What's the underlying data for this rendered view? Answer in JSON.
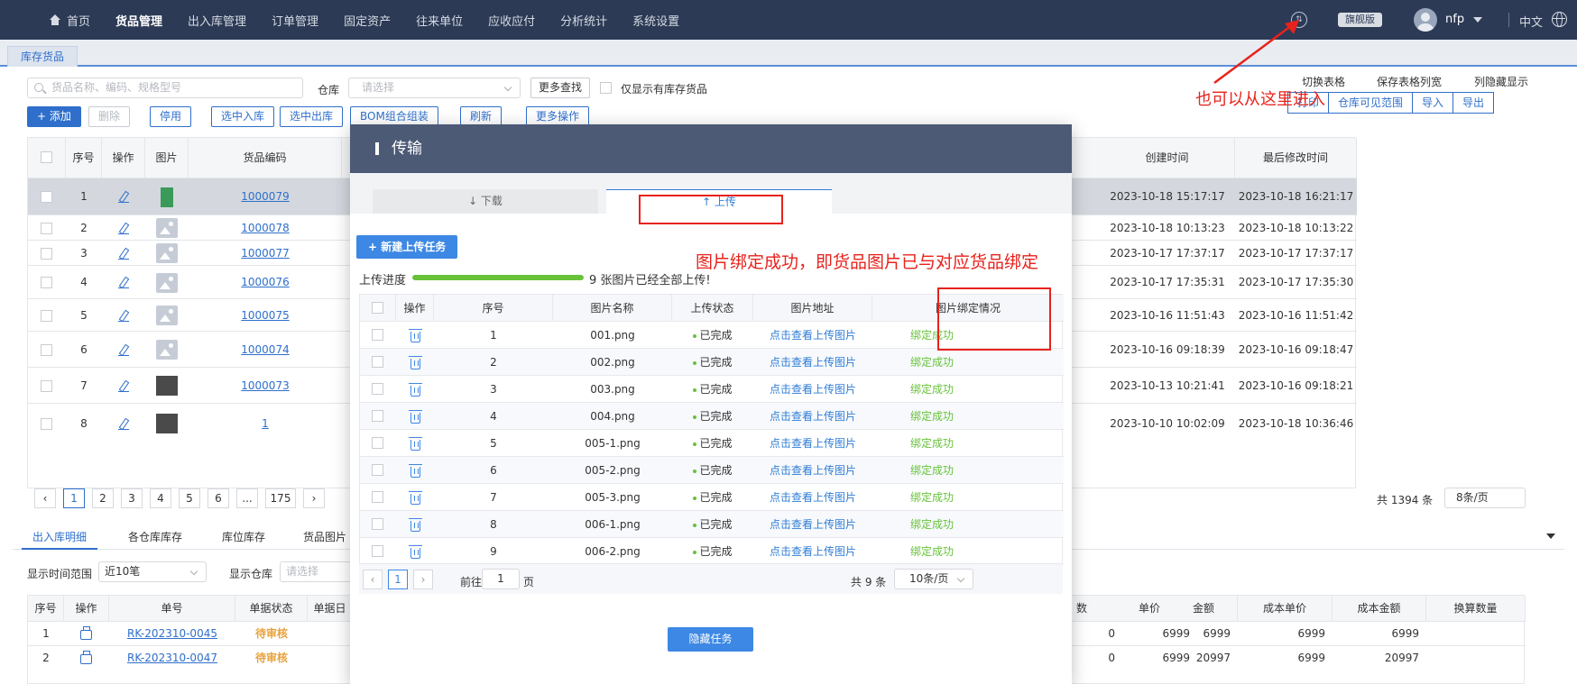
{
  "nav": {
    "items": [
      "首页",
      "货品管理",
      "出入库管理",
      "订单管理",
      "固定资产",
      "往来单位",
      "应收应付",
      "分析统计",
      "系统设置"
    ],
    "edition": "旗舰版",
    "user": "nfp",
    "language": "中文"
  },
  "page_tab": "库存货品",
  "toolbar": {
    "search_placeholder": "货品名称、编码、规格型号",
    "warehouse_label": "仓库",
    "warehouse_placeholder": "请选择",
    "more_search": "更多查找",
    "only_stock": "仅显示有库存货品",
    "buttons": [
      "+ 添加",
      "删除",
      "停用",
      "选中入库",
      "选中出库",
      "BOM组合组装",
      "刷新",
      "更多操作"
    ],
    "right_tools": [
      "切换表格",
      "保存表格列宽",
      "列隐藏显示"
    ],
    "right_buttons": [
      "打印",
      "仓库可见范围",
      "导入",
      "导出"
    ]
  },
  "goods_table": {
    "headers": [
      "序号",
      "操作",
      "图片",
      "货品编码",
      "创建时间",
      "最后修改时间"
    ],
    "rows": [
      {
        "no": "1",
        "code": "1000079",
        "created": "2023-10-18 15:17:17",
        "modified": "2023-10-18 16:21:17"
      },
      {
        "no": "2",
        "code": "1000078",
        "created": "2023-10-18 10:13:23",
        "modified": "2023-10-18 10:13:22"
      },
      {
        "no": "3",
        "code": "1000077",
        "created": "2023-10-17 17:37:17",
        "modified": "2023-10-17 17:37:17"
      },
      {
        "no": "4",
        "code": "1000076",
        "created": "2023-10-17 17:35:31",
        "modified": "2023-10-17 17:35:30"
      },
      {
        "no": "5",
        "code": "1000075",
        "created": "2023-10-16 11:51:43",
        "modified": "2023-10-16 11:51:42"
      },
      {
        "no": "6",
        "code": "1000074",
        "created": "2023-10-16 09:18:39",
        "modified": "2023-10-16 09:18:47"
      },
      {
        "no": "7",
        "code": "1000073",
        "created": "2023-10-13 10:21:41",
        "modified": "2023-10-16 09:18:21"
      },
      {
        "no": "8",
        "code": "1",
        "created": "2023-10-10 10:02:09",
        "modified": "2023-10-18 10:36:46"
      }
    ],
    "pages": [
      "1",
      "2",
      "3",
      "4",
      "5",
      "6",
      "...",
      "175"
    ],
    "total": "共 1394 条",
    "page_size": "8条/页"
  },
  "bottom": {
    "tabs": [
      "出入库明细",
      "各仓库库存",
      "库位库存",
      "货品图片"
    ],
    "time_label": "显示时间范围",
    "time_value": "近10笔",
    "wh_label": "显示仓库",
    "wh_placeholder": "请选择",
    "headers": [
      "序号",
      "操作",
      "单号",
      "单据状态",
      "单据日",
      "数",
      "单价",
      "金额",
      "成本单价",
      "成本金额",
      "换算数量"
    ],
    "rows": [
      {
        "no": "1",
        "code": "RK-202310-0045",
        "status": "待审核",
        "qty": "0",
        "price": "6999",
        "amount": "6999",
        "cost_price": "6999",
        "cost_amount": "6999"
      },
      {
        "no": "2",
        "code": "RK-202310-0047",
        "status": "待审核",
        "qty": "0",
        "price": "6999",
        "amount": "20997",
        "cost_price": "6999",
        "cost_amount": "20997"
      }
    ]
  },
  "modal": {
    "title": "传输",
    "tab_download": "↓ 下载",
    "tab_upload": "↑ 上传",
    "new_task": "+ 新建上传任务",
    "progress_label": "上传进度",
    "progress": 1.0,
    "progress_text": "9 张图片已经全部上传!",
    "headers": [
      "操作",
      "序号",
      "图片名称",
      "上传状态",
      "图片地址",
      "图片绑定情况"
    ],
    "rows": [
      {
        "no": "1",
        "name": "001.png",
        "status": "已完成",
        "url": "点击查看上传图片",
        "bind": "绑定成功"
      },
      {
        "no": "2",
        "name": "002.png",
        "status": "已完成",
        "url": "点击查看上传图片",
        "bind": "绑定成功"
      },
      {
        "no": "3",
        "name": "003.png",
        "status": "已完成",
        "url": "点击查看上传图片",
        "bind": "绑定成功"
      },
      {
        "no": "4",
        "name": "004.png",
        "status": "已完成",
        "url": "点击查看上传图片",
        "bind": "绑定成功"
      },
      {
        "no": "5",
        "name": "005-1.png",
        "status": "已完成",
        "url": "点击查看上传图片",
        "bind": "绑定成功"
      },
      {
        "no": "6",
        "name": "005-2.png",
        "status": "已完成",
        "url": "点击查看上传图片",
        "bind": "绑定成功"
      },
      {
        "no": "7",
        "name": "005-3.png",
        "status": "已完成",
        "url": "点击查看上传图片",
        "bind": "绑定成功"
      },
      {
        "no": "8",
        "name": "006-1.png",
        "status": "已完成",
        "url": "点击查看上传图片",
        "bind": "绑定成功"
      },
      {
        "no": "9",
        "name": "006-2.png",
        "status": "已完成",
        "url": "点击查看上传图片",
        "bind": "绑定成功"
      }
    ],
    "pager": {
      "page": "1",
      "goto_prefix": "前往",
      "goto_value": "1",
      "goto_suffix": "页",
      "total": "共 9 条",
      "size": "10条/页"
    },
    "hide_task": "隐藏任务"
  },
  "annotations": {
    "entry_hint": "也可以从这里进入",
    "bind_hint": "图片绑定成功，即货品图片已与对应货品绑定"
  },
  "colors": {
    "nav_bg": "#2c3a55",
    "primary": "#2f6fcb",
    "success": "#67c23a",
    "annotation": "#e8221c",
    "modal_header": "#4c5a75"
  }
}
